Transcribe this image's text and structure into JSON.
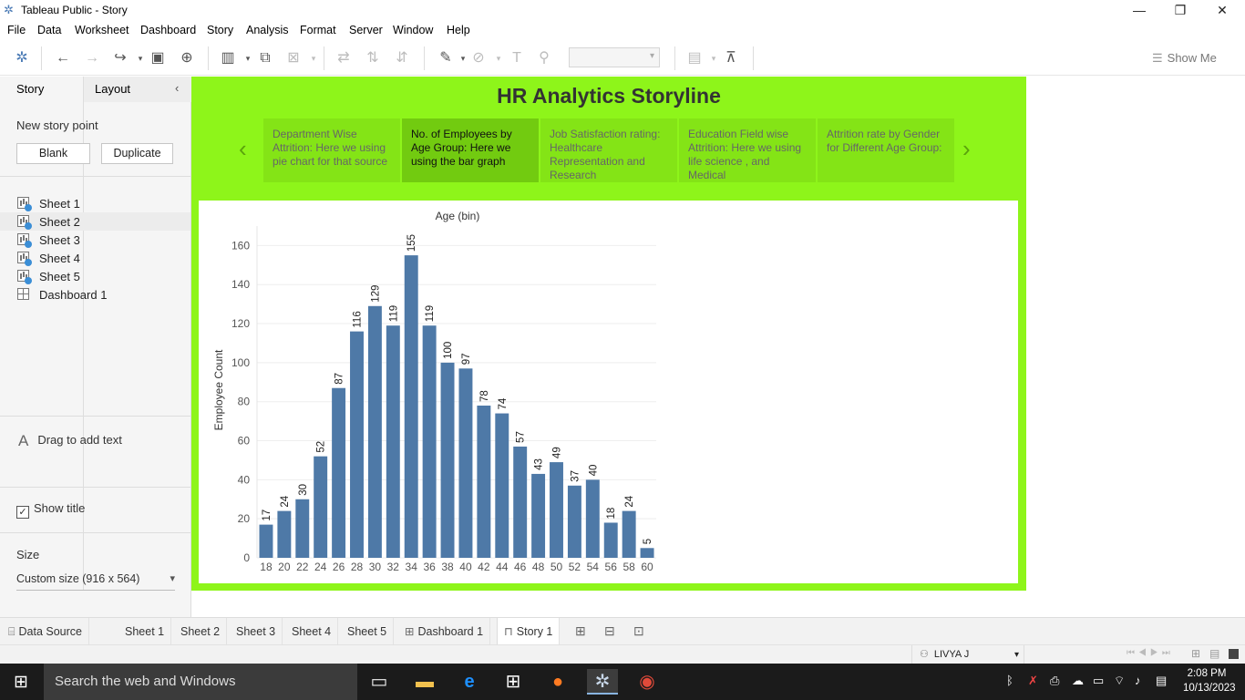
{
  "window": {
    "title": "Tableau Public - Story",
    "minimize": "—",
    "restore": "❐",
    "close": "✕"
  },
  "menu": [
    "File",
    "Data",
    "Worksheet",
    "Dashboard",
    "Story",
    "Analysis",
    "Format",
    "Server",
    "Window",
    "Help"
  ],
  "toolbar": {
    "show_me": "Show Me"
  },
  "left_panel": {
    "tab_story": "Story",
    "tab_layout": "Layout",
    "new_story_point": "New story point",
    "blank_button": "Blank",
    "duplicate_button": "Duplicate",
    "sheets": [
      "Sheet 1",
      "Sheet 2",
      "Sheet 3",
      "Sheet 4",
      "Sheet 5"
    ],
    "dashboard": "Dashboard 1",
    "drag_text": "Drag to add text",
    "show_title": "Show title",
    "size_label": "Size",
    "size_value": "Custom size (916 x 564)"
  },
  "story": {
    "title": "HR Analytics Storyline",
    "points": [
      "Department Wise Attrition: Here we using pie chart for that source",
      "No. of Employees by Age Group: Here we using the bar graph",
      "Job Satisfaction rating: Healthcare Representation and Research",
      "Education Field wise Attrition: Here we using life science , and Medical",
      "Attrition rate by Gender for Different Age Group:"
    ],
    "selected_point": 1
  },
  "chart_data": {
    "type": "bar",
    "title": "Age (bin)",
    "xlabel": "",
    "ylabel": "Employee Count",
    "categories": [
      "18",
      "20",
      "22",
      "24",
      "26",
      "28",
      "30",
      "32",
      "34",
      "36",
      "38",
      "40",
      "42",
      "44",
      "46",
      "48",
      "50",
      "52",
      "54",
      "56",
      "58",
      "60"
    ],
    "values": [
      17,
      24,
      30,
      52,
      87,
      116,
      129,
      119,
      155,
      119,
      100,
      97,
      78,
      74,
      57,
      43,
      49,
      37,
      40,
      18,
      24,
      5
    ],
    "yticks": [
      0,
      20,
      40,
      60,
      80,
      100,
      120,
      140,
      160
    ],
    "ylim": [
      0,
      170
    ],
    "bar_color": "#4e79a7",
    "grid": true
  },
  "bottom_tabs": {
    "data_source": "Data Source",
    "sheets": [
      "Sheet 1",
      "Sheet 2",
      "Sheet 3",
      "Sheet 4",
      "Sheet 5"
    ],
    "dashboard": "Dashboard 1",
    "story": "Story 1"
  },
  "status": {
    "user": "LIVYA J"
  },
  "taskbar": {
    "search": "Search the web and Windows",
    "time": "2:08 PM",
    "date": "10/13/2023"
  }
}
